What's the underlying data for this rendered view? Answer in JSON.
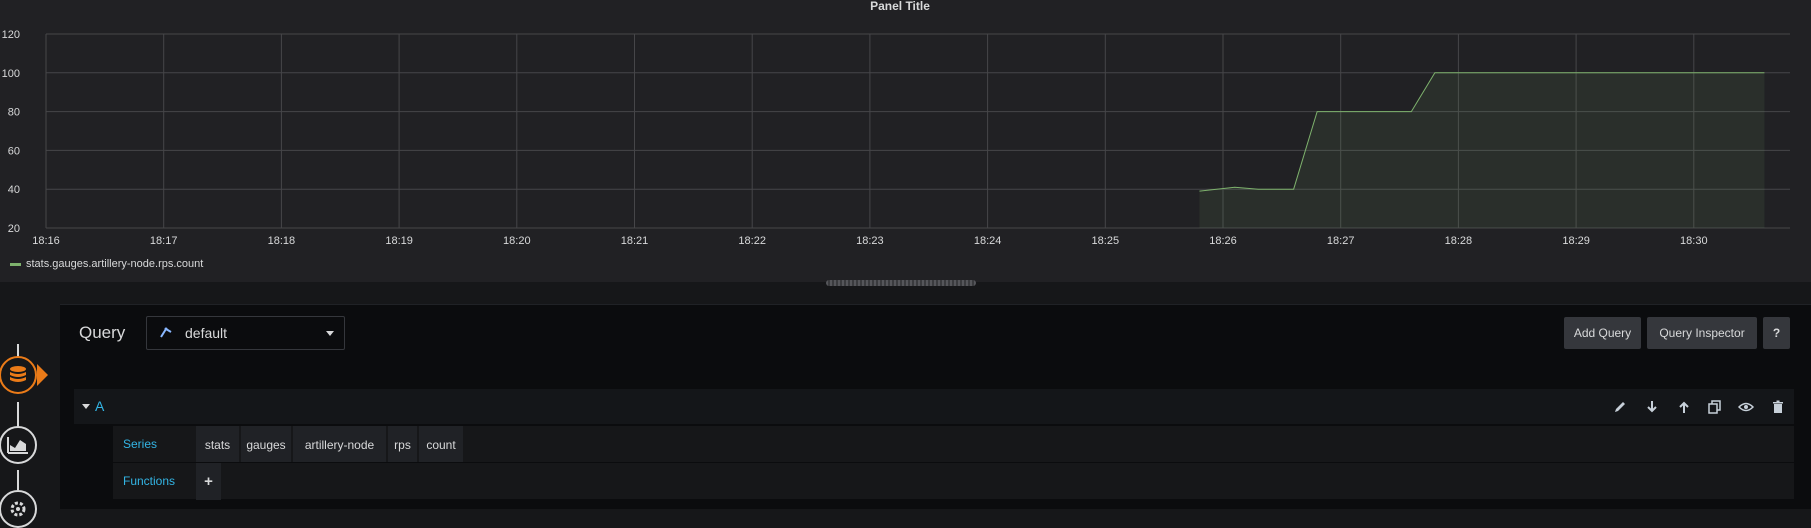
{
  "panel": {
    "title": "Panel Title",
    "legend_label": "stats.gauges.artillery-node.rps.count"
  },
  "colors": {
    "series": "#7eb26d",
    "accent_blue": "#33b5e5",
    "active_orange": "#eb7b18",
    "background": "#161719"
  },
  "chart_data": {
    "type": "line",
    "y_ticks": [
      "120",
      "100",
      "80",
      "60",
      "40",
      "20"
    ],
    "x_ticks": [
      "18:16",
      "18:17",
      "18:18",
      "18:19",
      "18:20",
      "18:21",
      "18:22",
      "18:23",
      "18:24",
      "18:25",
      "18:26",
      "18:27",
      "18:28",
      "18:29",
      "18:30"
    ],
    "ylim": [
      20,
      120
    ],
    "xlim_minutes": [
      "18:16",
      "18:30.7"
    ],
    "grid": true,
    "fill": true,
    "legend_position": "bottom-left",
    "series": [
      {
        "name": "stats.gauges.artillery-node.rps.count",
        "x": [
          "18:25.8",
          "18:26.1",
          "18:26.3",
          "18:26.6",
          "18:26.8",
          "18:27.0",
          "18:27.3",
          "18:27.6",
          "18:27.8",
          "18:28.0",
          "18:28.3",
          "18:28.6",
          "18:29.0",
          "18:29.5",
          "18:30.0",
          "18:30.6"
        ],
        "values": [
          39,
          41,
          40,
          40,
          80,
          80,
          80,
          80,
          100,
          100,
          100,
          100,
          100,
          100,
          100,
          100
        ]
      }
    ]
  },
  "editor": {
    "query_label": "Query",
    "datasource": "default",
    "add_query": "Add Query",
    "query_inspector": "Query Inspector",
    "help": "?",
    "query_ref": "A",
    "series_label": "Series",
    "functions_label": "Functions",
    "segments": [
      "stats",
      "gauges",
      "artillery-node",
      "rps",
      "count"
    ],
    "add_function": "+"
  },
  "icons": {
    "rail": [
      "database-icon",
      "chart-icon",
      "gear-icon"
    ],
    "row_actions": [
      "pencil-icon",
      "arrow-down-icon",
      "arrow-up-icon",
      "copy-icon",
      "eye-icon",
      "trash-icon"
    ]
  }
}
